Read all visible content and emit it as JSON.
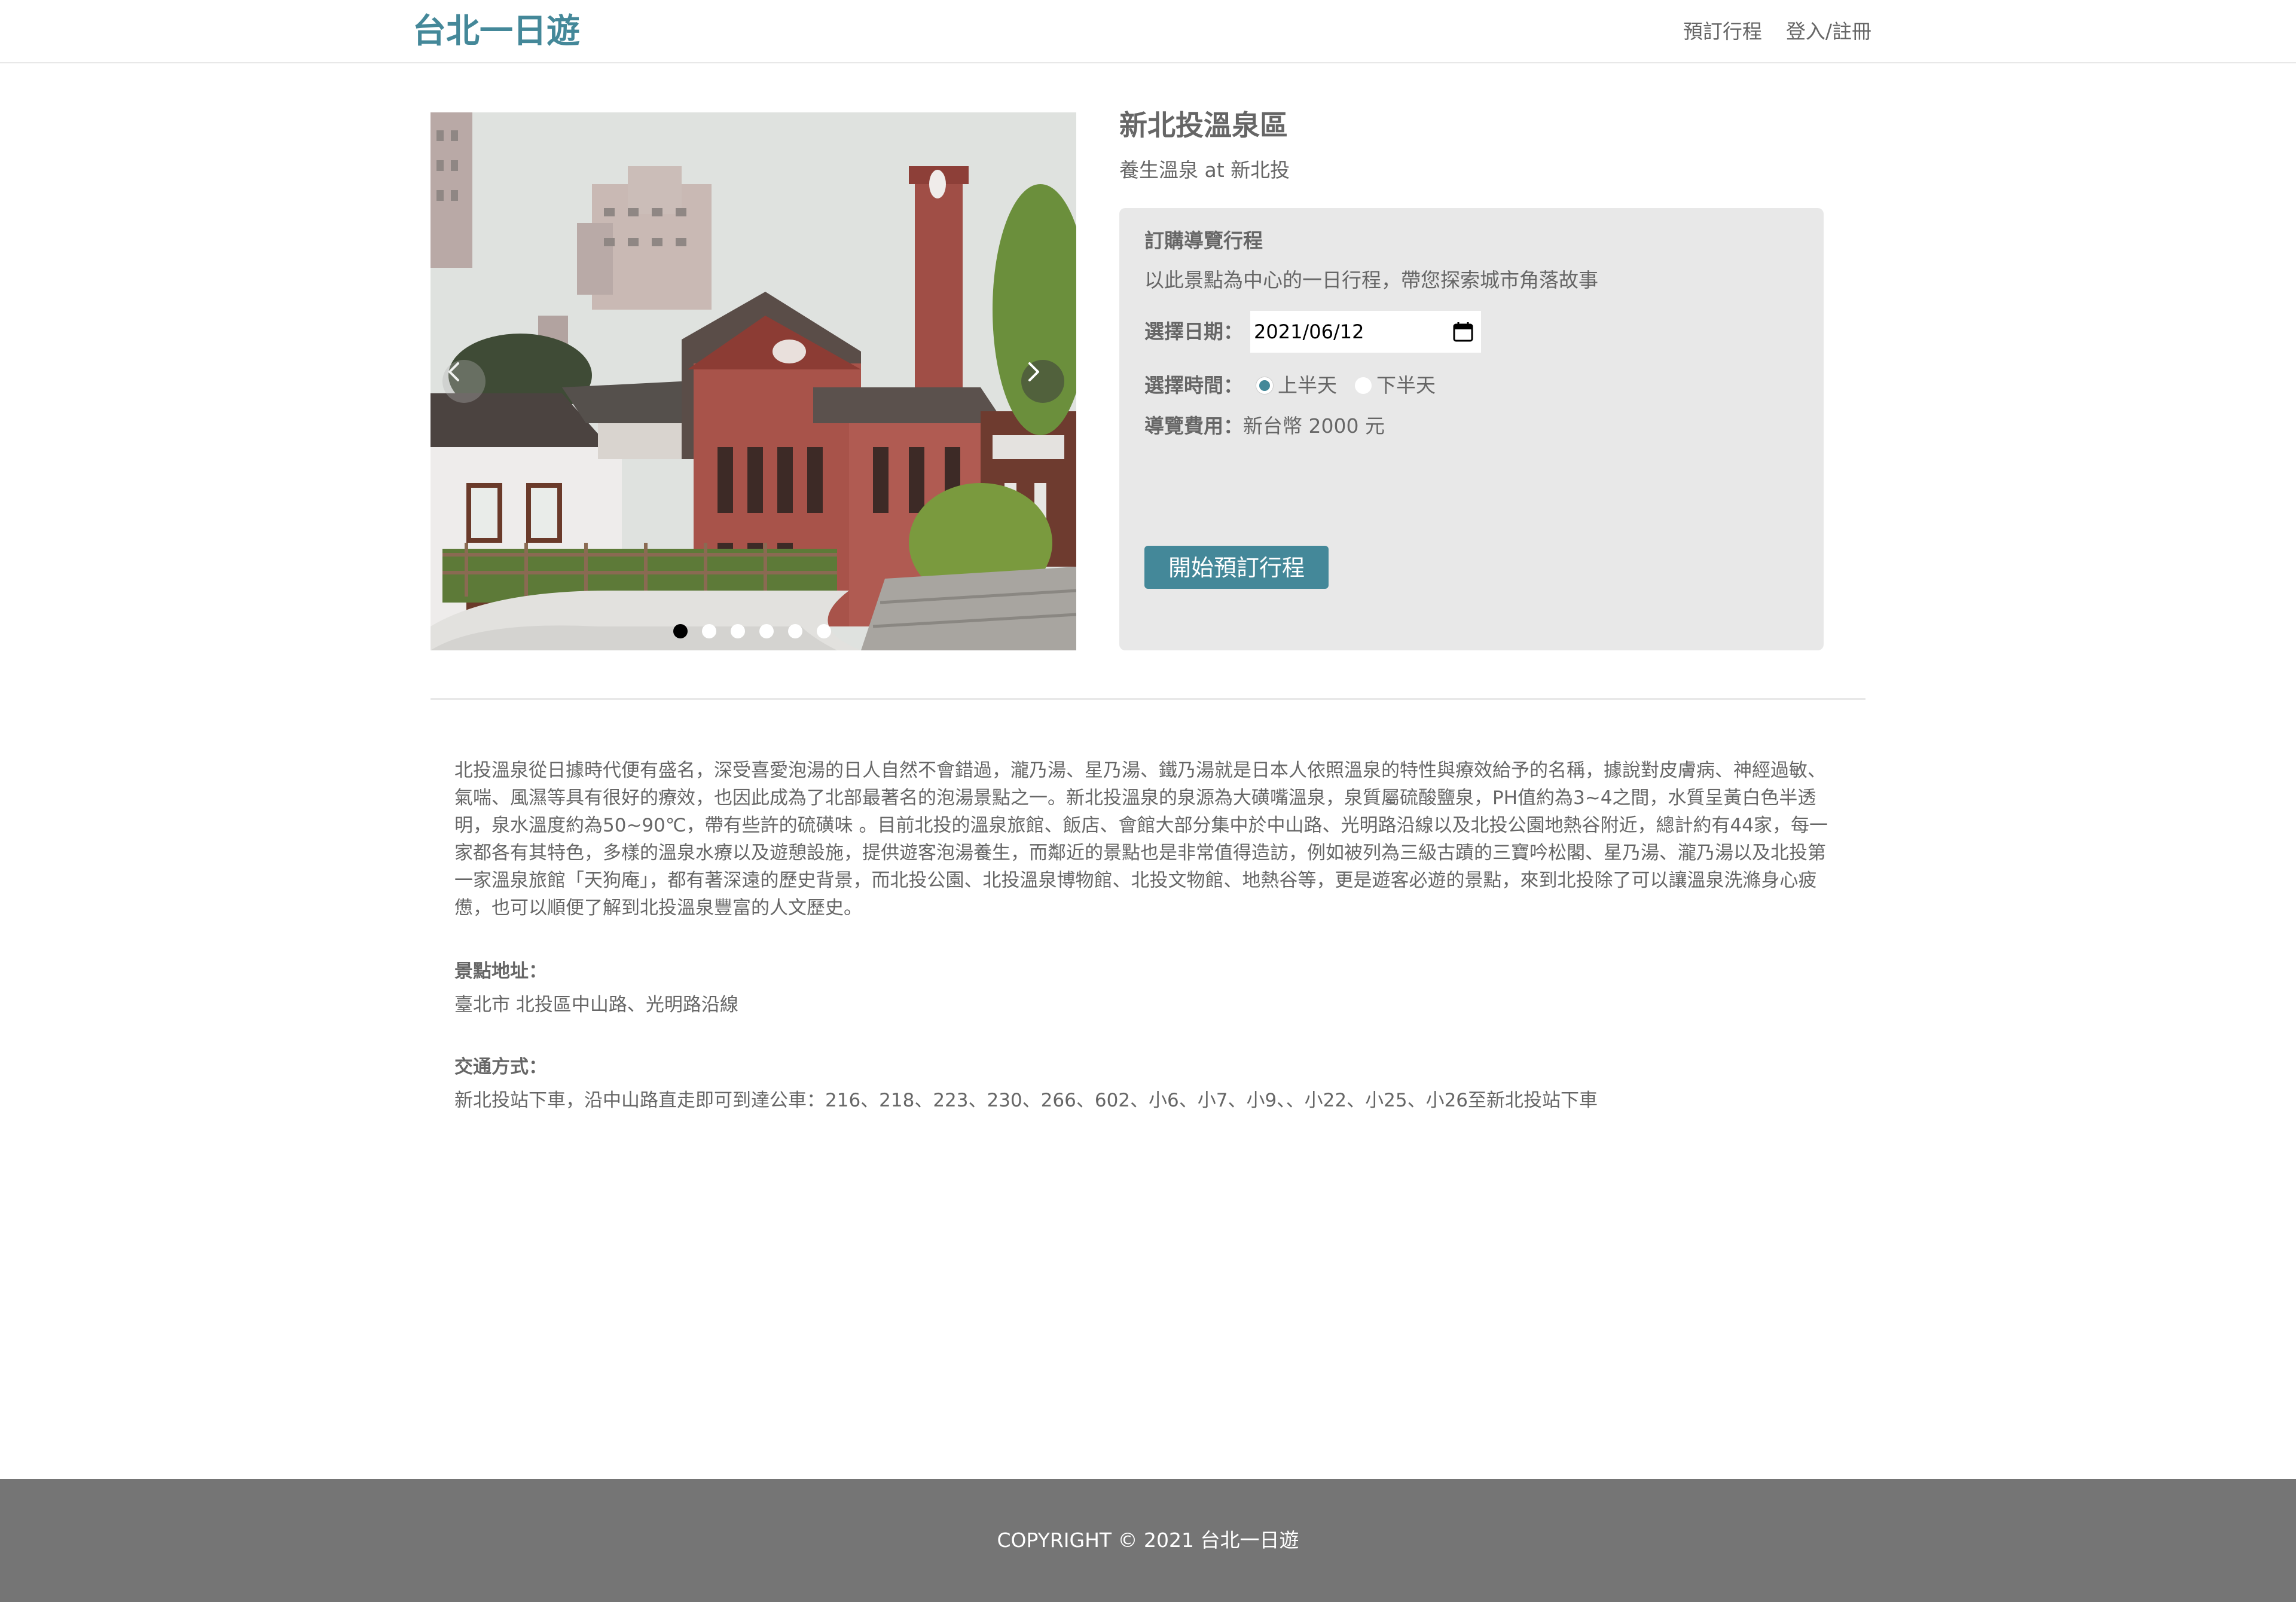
{
  "header": {
    "logo": "台北一日遊",
    "nav": {
      "booking": "預訂行程",
      "login": "登入/註冊"
    }
  },
  "attraction": {
    "name": "新北投溫泉區",
    "category_line": "養生溫泉 at 新北投"
  },
  "carousel": {
    "slide_count": 6,
    "active_index": 0
  },
  "booking": {
    "title": "訂購導覽行程",
    "description": "以此景點為中心的一日行程，帶您探索城市角落故事",
    "date_label": "選擇日期：",
    "date_value": "2021/06/12",
    "time_label": "選擇時間：",
    "time_options": [
      "上半天",
      "下半天"
    ],
    "time_selected": "上半天",
    "fee_label": "導覽費用：",
    "fee_value": "新台幣 2000 元",
    "submit_label": "開始預訂行程"
  },
  "description": "北投溫泉從日據時代便有盛名，深受喜愛泡湯的日人自然不會錯過，瀧乃湯、星乃湯、鐵乃湯就是日本人依照溫泉的特性與療效給予的名稱，據說對皮膚病、神經過敏、氣喘、風濕等具有很好的療效，也因此成為了北部最著名的泡湯景點之一。新北投溫泉的泉源為大磺嘴溫泉，泉質屬硫酸鹽泉，PH值約為3~4之間，水質呈黃白色半透明，泉水溫度約為50~90℃，帶有些許的硫磺味 。目前北投的溫泉旅館、飯店、會館大部分集中於中山路、光明路沿線以及北投公園地熱谷附近，總計約有44家，每一家都各有其特色，多樣的溫泉水療以及遊憩設施，提供遊客泡湯養生，而鄰近的景點也是非常值得造訪，例如被列為三級古蹟的三寶吟松閣、星乃湯、瀧乃湯以及北投第一家溫泉旅館「天狗庵」，都有著深遠的歷史背景，而北投公園、北投溫泉博物館、北投文物館、地熱谷等，更是遊客必遊的景點，來到北投除了可以讓溫泉洗滌身心疲憊，也可以順便了解到北投溫泉豐富的人文歷史。",
  "address": {
    "label": "景點地址：",
    "value": "臺北市 北投區中山路、光明路沿線"
  },
  "transport": {
    "label": "交通方式：",
    "value": "新北投站下車，沿中山路直走即可到達公車：216、218、223、230、266、602、小6、小7、小9、、小22、小25、小26至新北投站下車"
  },
  "footer": {
    "copyright": "COPYRIGHT © 2021 台北一日遊"
  },
  "colors": {
    "brand": "#448899",
    "panel_bg": "#e8e8e8",
    "footer_bg": "#757575",
    "text": "#666666"
  }
}
